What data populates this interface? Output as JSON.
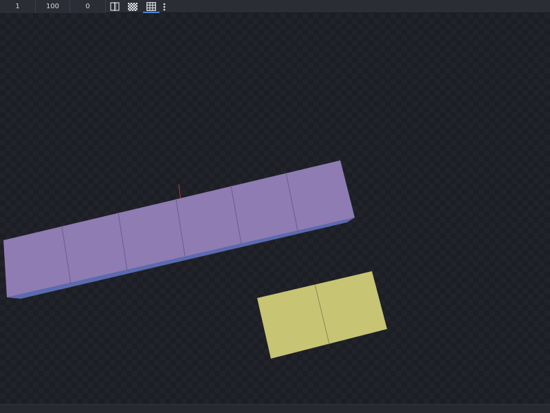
{
  "toolbar": {
    "fields": [
      {
        "value": "1"
      },
      {
        "value": "100"
      },
      {
        "value": "0"
      }
    ],
    "buttons": [
      {
        "icon": "split-view-icon"
      },
      {
        "icon": "checkerboard-icon"
      },
      {
        "icon": "grid-icon",
        "active": true
      },
      {
        "icon": "more-vertical-icon"
      }
    ],
    "accent_color": "#4a8bd6"
  },
  "viewport": {
    "background_color": "#1c1e24",
    "objects": [
      {
        "name": "purple-block-row",
        "color": "#8f7cb3",
        "segments": 6
      },
      {
        "name": "yellow-block-pair",
        "color": "#c7c474",
        "segments": 2
      }
    ],
    "origin_axis_color": "#d0302f"
  }
}
